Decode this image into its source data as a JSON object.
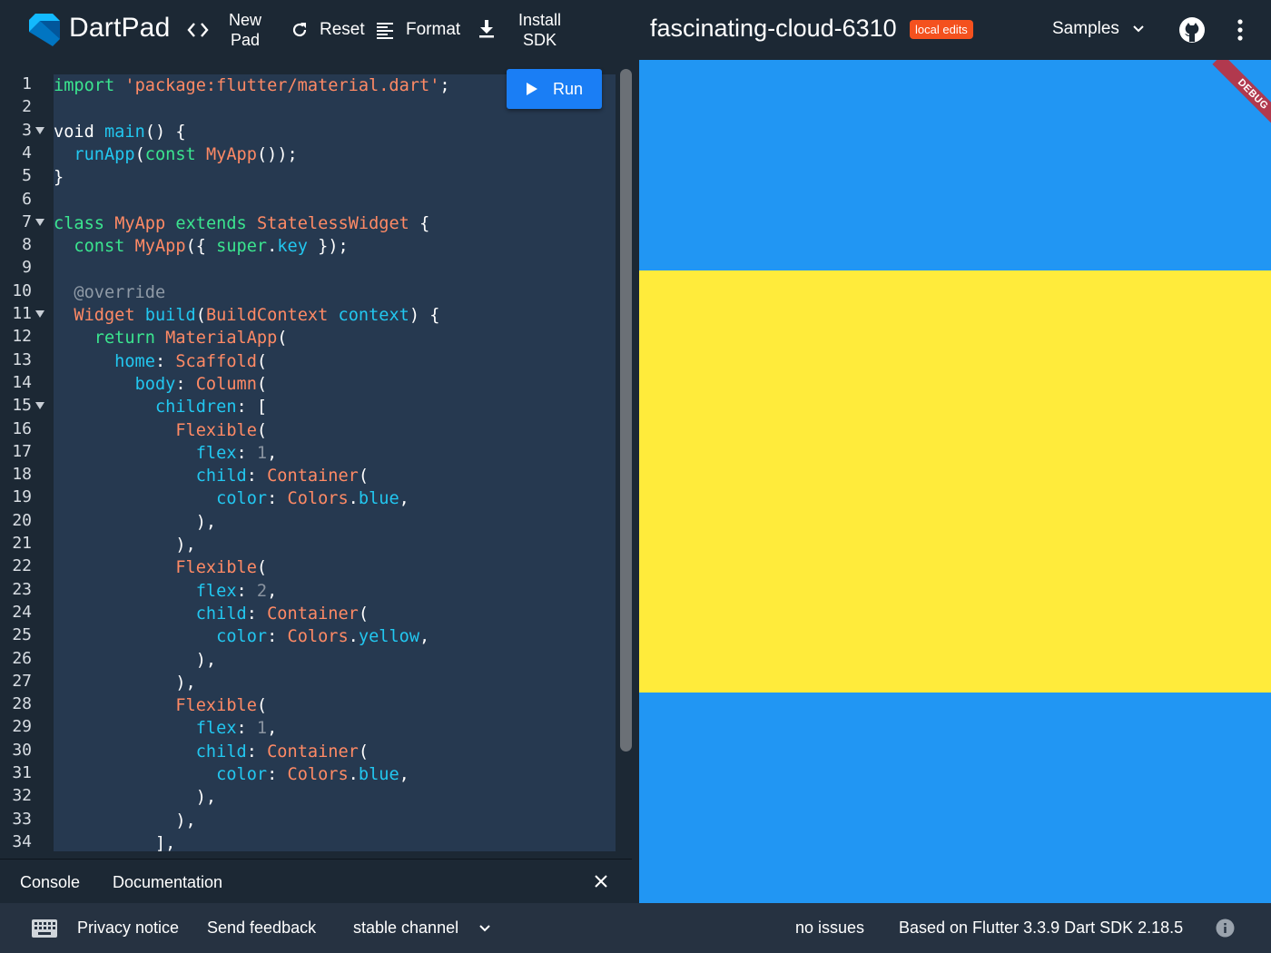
{
  "app": {
    "name": "DartPad",
    "snippet_title": "fascinating-cloud-6310",
    "status_badge": "local edits"
  },
  "toolbar": {
    "new_pad_line1": "New",
    "new_pad_line2": "Pad",
    "reset_label": "Reset",
    "format_label": "Format",
    "install_sdk_line1": "Install",
    "install_sdk_line2": "SDK",
    "samples_label": "Samples"
  },
  "editor": {
    "run_label": "Run",
    "line_numbers": [
      "1",
      "2",
      "3",
      "4",
      "5",
      "6",
      "7",
      "8",
      "9",
      "10",
      "11",
      "12",
      "13",
      "14",
      "15",
      "16",
      "17",
      "18",
      "19",
      "20",
      "21",
      "22",
      "23",
      "24",
      "25",
      "26",
      "27",
      "28",
      "29",
      "30",
      "31",
      "32",
      "33",
      "34"
    ],
    "fold_lines": [
      3,
      7,
      11,
      15
    ],
    "code_lines": [
      [
        [
          "kw",
          "import"
        ],
        [
          "pu",
          " "
        ],
        [
          "st",
          "'package:flutter/material.dart'"
        ],
        [
          "pu",
          ";"
        ]
      ],
      [],
      [
        [
          "pu",
          "void "
        ],
        [
          "fn",
          "main"
        ],
        [
          "pu",
          "() {"
        ]
      ],
      [
        [
          "pu",
          "  "
        ],
        [
          "fn",
          "runApp"
        ],
        [
          "pu",
          "("
        ],
        [
          "kw",
          "const"
        ],
        [
          "pu",
          " "
        ],
        [
          "ty",
          "MyApp"
        ],
        [
          "pu",
          "());"
        ]
      ],
      [
        [
          "pu",
          "}"
        ]
      ],
      [],
      [
        [
          "kw",
          "class"
        ],
        [
          "pu",
          " "
        ],
        [
          "ty",
          "MyApp"
        ],
        [
          "pu",
          " "
        ],
        [
          "kw",
          "extends"
        ],
        [
          "pu",
          " "
        ],
        [
          "ty",
          "StatelessWidget"
        ],
        [
          "pu",
          " {"
        ]
      ],
      [
        [
          "pu",
          "  "
        ],
        [
          "kw",
          "const"
        ],
        [
          "pu",
          " "
        ],
        [
          "ty",
          "MyApp"
        ],
        [
          "pu",
          "({ "
        ],
        [
          "kw",
          "super"
        ],
        [
          "pu",
          "."
        ],
        [
          "fn",
          "key"
        ],
        [
          "pu",
          " });"
        ]
      ],
      [],
      [
        [
          "pu",
          "  "
        ],
        [
          "an",
          "@override"
        ]
      ],
      [
        [
          "pu",
          "  "
        ],
        [
          "ty",
          "Widget"
        ],
        [
          "pu",
          " "
        ],
        [
          "fn",
          "build"
        ],
        [
          "pu",
          "("
        ],
        [
          "ty",
          "BuildContext"
        ],
        [
          "pu",
          " "
        ],
        [
          "fn",
          "context"
        ],
        [
          "pu",
          ") {"
        ]
      ],
      [
        [
          "pu",
          "    "
        ],
        [
          "kw",
          "return"
        ],
        [
          "pu",
          " "
        ],
        [
          "ty",
          "MaterialApp"
        ],
        [
          "pu",
          "("
        ]
      ],
      [
        [
          "pu",
          "      "
        ],
        [
          "pr",
          "home"
        ],
        [
          "pu",
          ": "
        ],
        [
          "ty",
          "Scaffold"
        ],
        [
          "pu",
          "("
        ]
      ],
      [
        [
          "pu",
          "        "
        ],
        [
          "pr",
          "body"
        ],
        [
          "pu",
          ": "
        ],
        [
          "ty",
          "Column"
        ],
        [
          "pu",
          "("
        ]
      ],
      [
        [
          "pu",
          "          "
        ],
        [
          "pr",
          "children"
        ],
        [
          "pu",
          ": ["
        ]
      ],
      [
        [
          "pu",
          "            "
        ],
        [
          "ty",
          "Flexible"
        ],
        [
          "pu",
          "("
        ]
      ],
      [
        [
          "pu",
          "              "
        ],
        [
          "pr",
          "flex"
        ],
        [
          "pu",
          ": "
        ],
        [
          "nm",
          "1"
        ],
        [
          "pu",
          ","
        ]
      ],
      [
        [
          "pu",
          "              "
        ],
        [
          "pr",
          "child"
        ],
        [
          "pu",
          ": "
        ],
        [
          "ty",
          "Container"
        ],
        [
          "pu",
          "("
        ]
      ],
      [
        [
          "pu",
          "                "
        ],
        [
          "pr",
          "color"
        ],
        [
          "pu",
          ": "
        ],
        [
          "ty",
          "Colors"
        ],
        [
          "pu",
          "."
        ],
        [
          "fn",
          "blue"
        ],
        [
          "pu",
          ","
        ]
      ],
      [
        [
          "pu",
          "              ),"
        ]
      ],
      [
        [
          "pu",
          "            ),"
        ]
      ],
      [
        [
          "pu",
          "            "
        ],
        [
          "ty",
          "Flexible"
        ],
        [
          "pu",
          "("
        ]
      ],
      [
        [
          "pu",
          "              "
        ],
        [
          "pr",
          "flex"
        ],
        [
          "pu",
          ": "
        ],
        [
          "nm",
          "2"
        ],
        [
          "pu",
          ","
        ]
      ],
      [
        [
          "pu",
          "              "
        ],
        [
          "pr",
          "child"
        ],
        [
          "pu",
          ": "
        ],
        [
          "ty",
          "Container"
        ],
        [
          "pu",
          "("
        ]
      ],
      [
        [
          "pu",
          "                "
        ],
        [
          "pr",
          "color"
        ],
        [
          "pu",
          ": "
        ],
        [
          "ty",
          "Colors"
        ],
        [
          "pu",
          "."
        ],
        [
          "fn",
          "yellow"
        ],
        [
          "pu",
          ","
        ]
      ],
      [
        [
          "pu",
          "              ),"
        ]
      ],
      [
        [
          "pu",
          "            ),"
        ]
      ],
      [
        [
          "pu",
          "            "
        ],
        [
          "ty",
          "Flexible"
        ],
        [
          "pu",
          "("
        ]
      ],
      [
        [
          "pu",
          "              "
        ],
        [
          "pr",
          "flex"
        ],
        [
          "pu",
          ": "
        ],
        [
          "nm",
          "1"
        ],
        [
          "pu",
          ","
        ]
      ],
      [
        [
          "pu",
          "              "
        ],
        [
          "pr",
          "child"
        ],
        [
          "pu",
          ": "
        ],
        [
          "ty",
          "Container"
        ],
        [
          "pu",
          "("
        ]
      ],
      [
        [
          "pu",
          "                "
        ],
        [
          "pr",
          "color"
        ],
        [
          "pu",
          ": "
        ],
        [
          "ty",
          "Colors"
        ],
        [
          "pu",
          "."
        ],
        [
          "fn",
          "blue"
        ],
        [
          "pu",
          ","
        ]
      ],
      [
        [
          "pu",
          "              ),"
        ]
      ],
      [
        [
          "pu",
          "            ),"
        ]
      ],
      [
        [
          "pu",
          "          ],"
        ]
      ]
    ]
  },
  "console": {
    "tab_console": "Console",
    "tab_documentation": "Documentation"
  },
  "preview": {
    "debug_banner": "DEBUG",
    "bands": [
      {
        "color": "#2196f3",
        "flex": 1
      },
      {
        "color": "#ffeb3b",
        "flex": 2
      },
      {
        "color": "#2196f3",
        "flex": 1
      }
    ]
  },
  "footer": {
    "privacy_notice": "Privacy notice",
    "send_feedback": "Send feedback",
    "channel": "stable channel",
    "issues": "no issues",
    "version": "Based on Flutter 3.3.9 Dart SDK 2.18.5"
  },
  "colors": {
    "background": "#1c2834",
    "editor_bg": "#263950",
    "run_button": "#1a7ef5",
    "badge": "#f4511e",
    "footer_bg": "#263241"
  }
}
